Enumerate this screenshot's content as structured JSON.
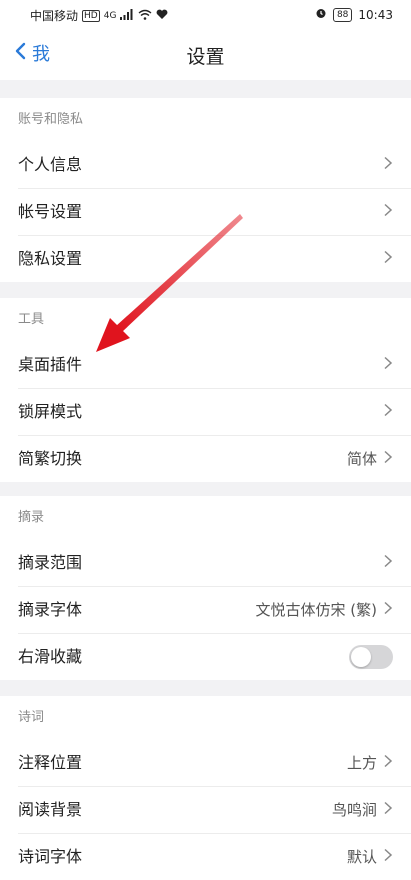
{
  "status_bar": {
    "carrier": "中国移动",
    "network": "HD",
    "signal": "4G",
    "battery": "88",
    "time": "10:43"
  },
  "nav": {
    "back_label": "我",
    "title": "设置"
  },
  "sections": [
    {
      "header": "账号和隐私",
      "rows": [
        {
          "label": "个人信息",
          "value": "",
          "control": "chevron"
        },
        {
          "label": "帐号设置",
          "value": "",
          "control": "chevron"
        },
        {
          "label": "隐私设置",
          "value": "",
          "control": "chevron"
        }
      ]
    },
    {
      "header": "工具",
      "rows": [
        {
          "label": "桌面插件",
          "value": "",
          "control": "chevron"
        },
        {
          "label": "锁屏模式",
          "value": "",
          "control": "chevron"
        },
        {
          "label": "简繁切换",
          "value": "简体",
          "control": "chevron"
        }
      ]
    },
    {
      "header": "摘录",
      "rows": [
        {
          "label": "摘录范围",
          "value": "",
          "control": "chevron"
        },
        {
          "label": "摘录字体",
          "value": "文悦古体仿宋 (繁)",
          "control": "chevron"
        },
        {
          "label": "右滑收藏",
          "value": "",
          "control": "toggle",
          "toggle_on": false
        }
      ]
    },
    {
      "header": "诗词",
      "rows": [
        {
          "label": "注释位置",
          "value": "上方",
          "control": "chevron"
        },
        {
          "label": "阅读背景",
          "value": "鸟鸣涧",
          "control": "chevron"
        },
        {
          "label": "诗词字体",
          "value": "默认",
          "control": "chevron"
        }
      ]
    }
  ],
  "colors": {
    "accent": "#2a7ad8",
    "annotation_arrow": "#e0141e",
    "background": "#f2f2f4"
  }
}
